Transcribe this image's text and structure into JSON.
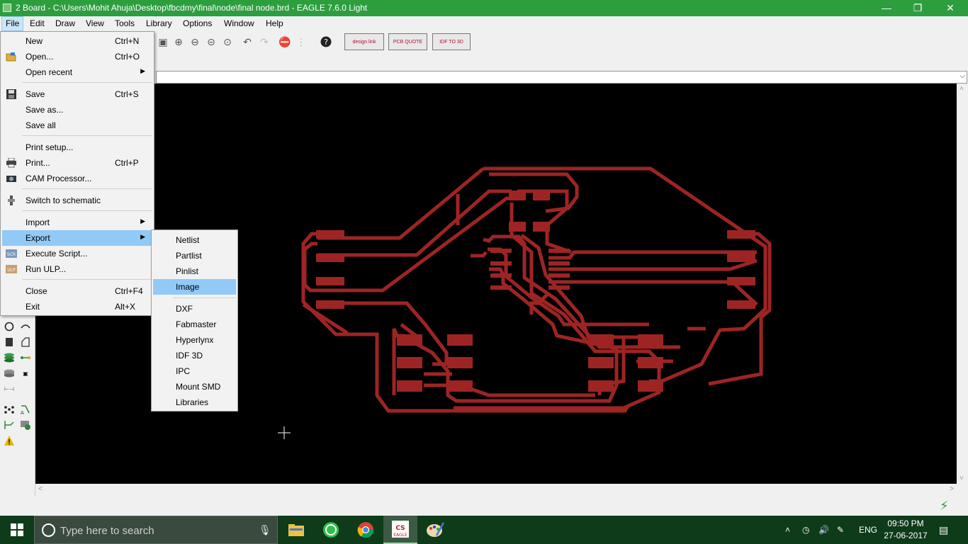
{
  "window": {
    "title": "2 Board - C:\\Users\\Mohit Ahuja\\Desktop\\fbcdmy\\final\\node\\final node.brd - EAGLE 7.6.0 Light",
    "minimize": "—",
    "restore": "❐",
    "close": "✕"
  },
  "menubar": [
    "File",
    "Edit",
    "Draw",
    "View",
    "Tools",
    "Library",
    "Options",
    "Window",
    "Help"
  ],
  "toolbar": {
    "design_link": "design link",
    "pcb_quote": "PCB QUOTE",
    "idf_to_3d": "IDF TO 3D",
    "help": "?"
  },
  "file_menu": {
    "items": [
      {
        "label": "New",
        "shortcut": "Ctrl+N",
        "icon": "new-icon"
      },
      {
        "label": "Open...",
        "shortcut": "Ctrl+O",
        "icon": "open-folder-icon"
      },
      {
        "label": "Open recent",
        "shortcut": "",
        "icon": "",
        "submenu": true
      },
      {
        "label": "Save",
        "shortcut": "Ctrl+S",
        "icon": "floppy-icon"
      },
      {
        "label": "Save as...",
        "shortcut": "",
        "icon": ""
      },
      {
        "label": "Save all",
        "shortcut": "",
        "icon": ""
      },
      {
        "label": "Print setup...",
        "shortcut": "",
        "icon": ""
      },
      {
        "label": "Print...",
        "shortcut": "Ctrl+P",
        "icon": "printer-icon"
      },
      {
        "label": "CAM Processor...",
        "shortcut": "",
        "icon": "cam-icon"
      },
      {
        "label": "Switch to schematic",
        "shortcut": "",
        "icon": "switch-icon"
      },
      {
        "label": "Import",
        "shortcut": "",
        "icon": "",
        "submenu": true
      },
      {
        "label": "Export",
        "shortcut": "",
        "icon": "",
        "submenu": true
      },
      {
        "label": "Execute Script...",
        "shortcut": "",
        "icon": "script-icon"
      },
      {
        "label": "Run ULP...",
        "shortcut": "",
        "icon": "ulp-icon"
      },
      {
        "label": "Close",
        "shortcut": "Ctrl+F4",
        "icon": ""
      },
      {
        "label": "Exit",
        "shortcut": "Alt+X",
        "icon": ""
      }
    ],
    "highlighted": "Export",
    "icon_labels": {
      "script": "SCR",
      "ulp": "ULP"
    }
  },
  "export_menu": {
    "items": [
      "Netlist",
      "Partlist",
      "Pinlist",
      "Image",
      "DXF",
      "Fabmaster",
      "Hyperlynx",
      "IDF 3D",
      "IPC",
      "Mount SMD",
      "Libraries"
    ],
    "highlighted": "Image"
  },
  "taskbar": {
    "search_placeholder": "Type here to search",
    "language": "ENG",
    "time": "09:50 PM",
    "date": "27-06-2017",
    "eagle_label": "EAGLE"
  },
  "colors": {
    "titlebar": "#2d9e3e",
    "canvas": "#000000",
    "trace": "#9e2424",
    "menu_highlight": "#91c9f7",
    "taskbar": "#0e3b1a"
  }
}
